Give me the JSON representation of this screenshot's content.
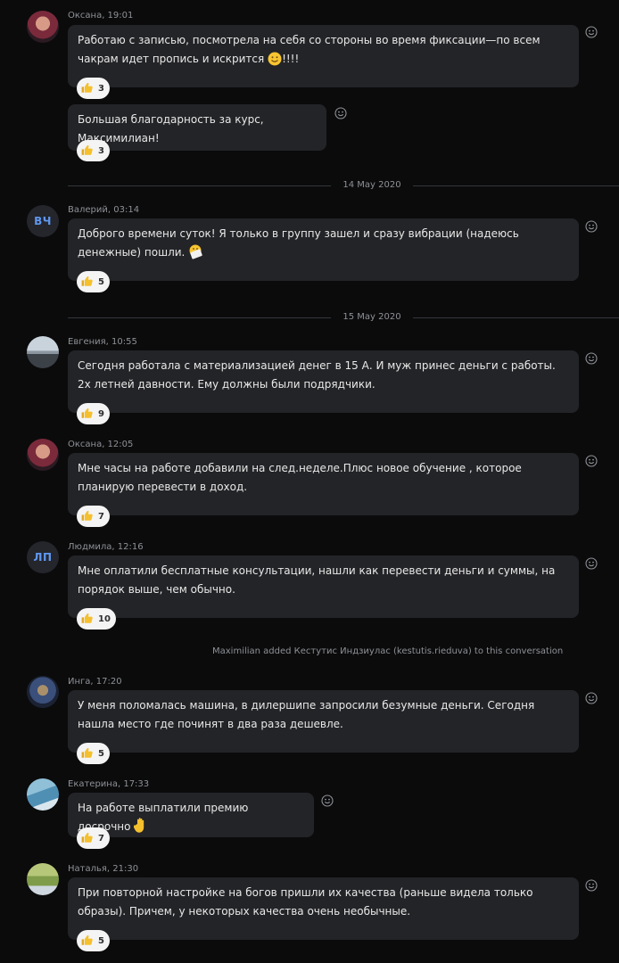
{
  "messages": [
    {
      "author_time": "Оксана, 19:01",
      "text": "Работаю с записью, посмотрела на себя со стороны во время фиксации—по всем чакрам идет пропись и искрится",
      "text_after": "!!!!",
      "reactions": "3"
    },
    {
      "text": "Большая благодарность за курс, Максимилиан!",
      "reactions": "3"
    },
    {
      "author_time": "Валерий, 03:14",
      "avatar_initials": "ВЧ",
      "text": "Доброго времени суток! Я только в группу зашел и сразу вибрации (надеюсь денежные) пошли.",
      "reactions": "5"
    },
    {
      "author_time": "Евгения, 10:55",
      "text": "Сегодня работала с материализацией денег в 15 А. И муж принес деньги с работы. 2х летней давности. Ему должны были подрядчики.",
      "reactions": "9"
    },
    {
      "author_time": "Оксана, 12:05",
      "text": "Мне часы на работе добавили на след.неделе.Плюс новое обучение , которое планирую перевести в доход.",
      "reactions": "7"
    },
    {
      "author_time": "Людмила, 12:16",
      "avatar_initials": "ЛП",
      "text": "Мне оплатили бесплатные консультации, нашли как перевести деньги и суммы, на порядок выше, чем обычно.",
      "reactions": "10"
    },
    {
      "author_time": "Инга, 17:20",
      "text": "У меня поломалась машина, в дилершипе запросили безумные деньги. Сегодня нашла место где починят в два раза дешевле.",
      "reactions": "5"
    },
    {
      "author_time": "Екатерина, 17:33",
      "text": "На работе выплатили премию досрочно",
      "reactions": "7"
    },
    {
      "author_time": "Наталья, 21:30",
      "text": "При повторной настройке на богов пришли их качества (раньше видела только образы). Причем, у некоторых качества очень необычные.",
      "reactions": "5"
    }
  ],
  "dates": [
    "14 May 2020",
    "15 May 2020"
  ],
  "system_message": "Maximilian added Кестутис Индзиулас (kestutis.rieduva) to this conversation",
  "icons": {
    "reaction": "thumbs-up-icon",
    "add_reaction": "smiley-icon"
  },
  "colors": {
    "background": "#0b0b0c",
    "bubble": "#232427",
    "initials": "#5f97f0",
    "meta": "#8e9196"
  }
}
